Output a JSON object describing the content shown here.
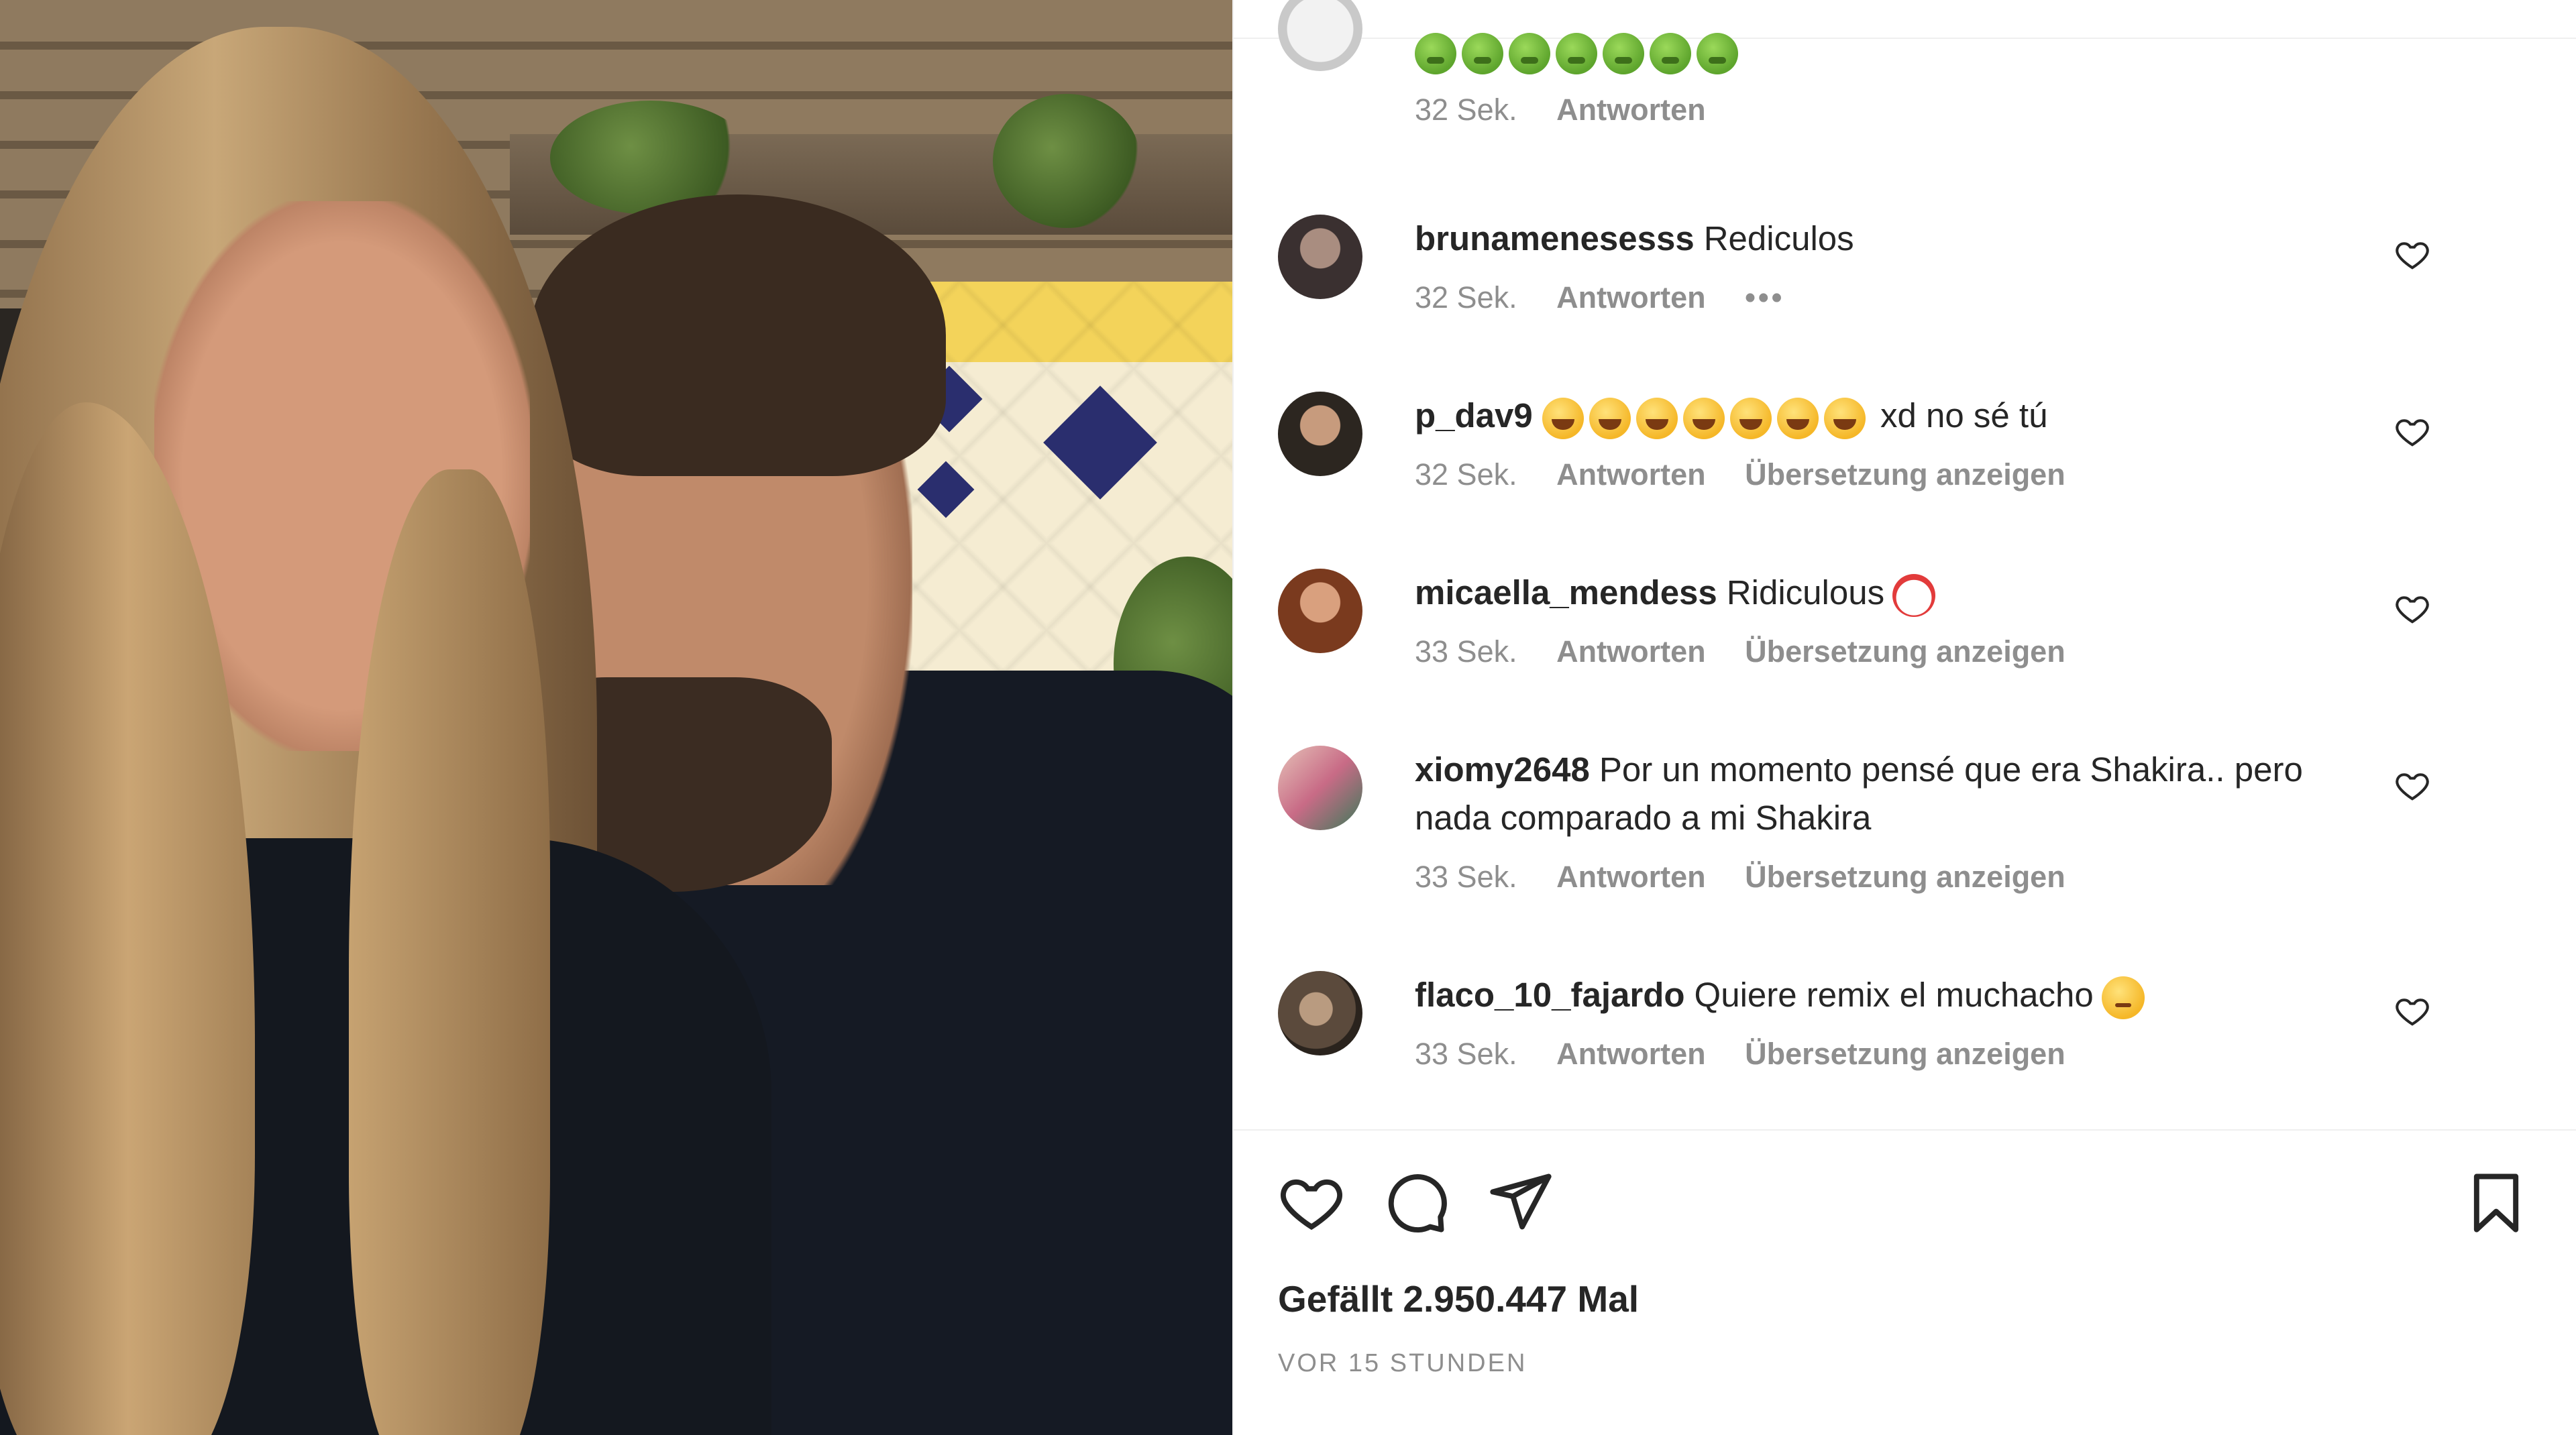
{
  "comments": [
    {
      "username": "",
      "text": "",
      "emoji_count": 7,
      "time": "32 Sek.",
      "reply_label": "Antworten"
    },
    {
      "username": "brunamenesesss",
      "text": "Rediculos",
      "time": "32 Sek.",
      "reply_label": "Antworten",
      "more_label": "•••"
    },
    {
      "username": "p_dav9",
      "text": "xd no sé tú",
      "time": "32 Sek.",
      "reply_label": "Antworten",
      "translate_label": "Übersetzung anzeigen"
    },
    {
      "username": "micaella_mendess",
      "text": "Ridiculous",
      "time": "33 Sek.",
      "reply_label": "Antworten",
      "translate_label": "Übersetzung anzeigen"
    },
    {
      "username": "xiomy2648",
      "text": "Por un momento pensé que era Shakira.. pero nada comparado a mi Shakira",
      "time": "33 Sek.",
      "reply_label": "Antworten",
      "translate_label": "Übersetzung anzeigen"
    },
    {
      "username": "flaco_10_fajardo",
      "text": "Quiere remix el muchacho",
      "time": "33 Sek.",
      "reply_label": "Antworten",
      "translate_label": "Übersetzung anzeigen"
    }
  ],
  "actions": {
    "likes": "Gefällt 2.950.447 Mal",
    "posted": "VOR 15 STUNDEN"
  },
  "colors": {
    "text": "#262626",
    "meta": "#8e8e8e",
    "divider": "#efefef"
  },
  "icons": [
    "heart-icon",
    "comment-icon",
    "share-icon",
    "bookmark-icon"
  ]
}
